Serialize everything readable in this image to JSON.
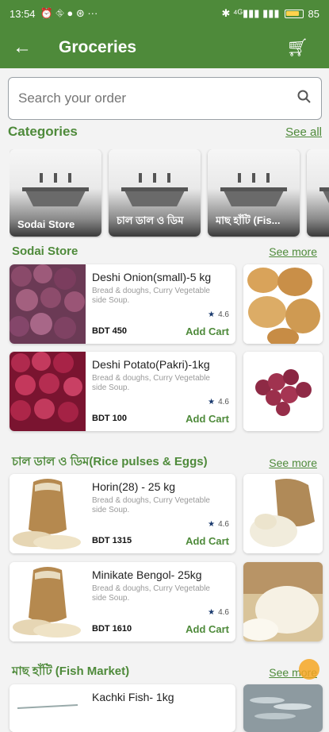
{
  "status": {
    "time": "13:54",
    "left_icons": "⏰ ⛗ ● ⊛ ···",
    "right_icons": "✱ ⁴ᴳ▮▮▮ ▮▮▮",
    "battery": "85"
  },
  "appbar": {
    "title": "Groceries"
  },
  "search": {
    "placeholder": "Search your order"
  },
  "categories": {
    "title": "Categories",
    "see_all": "See all",
    "items": [
      {
        "label": "Sodai Store"
      },
      {
        "label": "চাল ডাল ও ডিম"
      },
      {
        "label": "মাছ হাঁটি (Fis..."
      }
    ]
  },
  "sections": [
    {
      "title": "Sodai Store",
      "see_more": "See more",
      "products": [
        {
          "name": "Deshi Onion(small)-5 kg",
          "desc": "Bread & doughs, Curry Vegetable side Soup.",
          "rating": "4.6",
          "price": "BDT 450",
          "add": "Add Cart"
        },
        {
          "name": "Deshi Potato(Pakri)-1kg",
          "desc": "Bread & doughs, Curry Vegetable side Soup.",
          "rating": "4.6",
          "price": "BDT 100",
          "add": "Add Cart"
        }
      ]
    },
    {
      "title": "চাল ডাল ও ডিম(Rice pulses & Eggs)",
      "see_more": "See more",
      "products": [
        {
          "name": "Horin(28) - 25 kg",
          "desc": "Bread & doughs, Curry Vegetable side Soup.",
          "rating": "4.6",
          "price": "BDT 1315",
          "add": "Add Cart"
        },
        {
          "name": "Minikate Bengol- 25kg",
          "desc": "Bread & doughs, Curry Vegetable side Soup.",
          "rating": "4.6",
          "price": "BDT 1610",
          "add": "Add Cart"
        }
      ]
    },
    {
      "title": "মাছ হাঁটি (Fish Market)",
      "see_more": "See more",
      "products": [
        {
          "name": "Kachki Fish- 1kg"
        }
      ]
    }
  ],
  "colors": {
    "primary": "#4e8a3a",
    "accent": "#f5a623"
  }
}
